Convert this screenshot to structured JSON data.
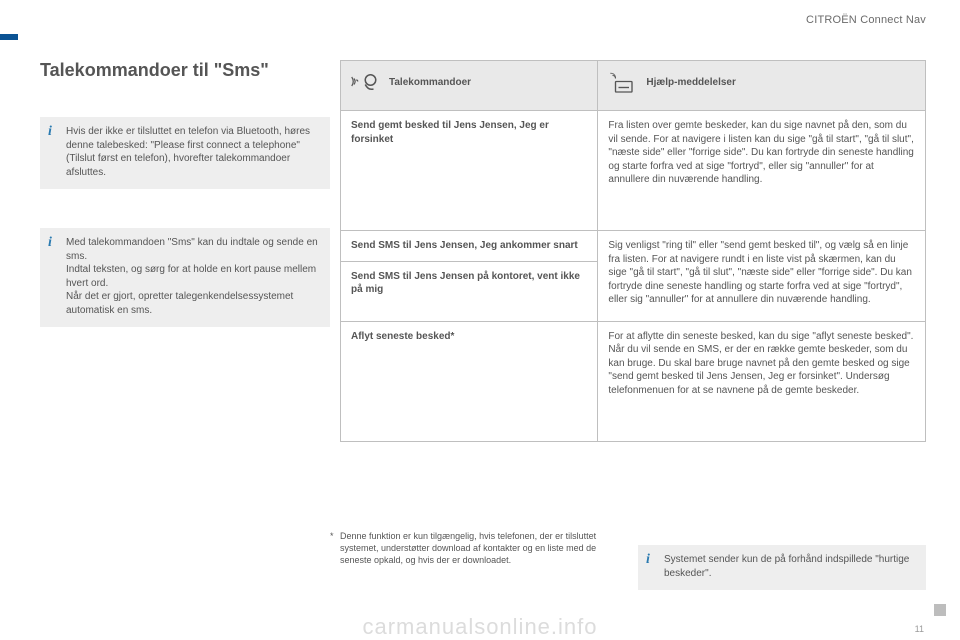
{
  "brand": "CITROËN Connect Nav",
  "title": "Talekommandoer til \"Sms\"",
  "info_boxes": {
    "info1": "Hvis der ikke er tilsluttet en telefon via Bluetooth, høres denne talebesked: \"Please first connect a telephone\" (Tilslut først en telefon), hvorefter talekommandoer afsluttes.",
    "info2": "Med talekommandoen \"Sms\" kan du indtale og sende en sms.\nIndtal teksten, og sørg for at holde en kort pause mellem hvert ord.\nNår det er gjort, opretter talegenkendelsessystemet automatisk en sms.",
    "info3": "Systemet sender kun de på forhånd indspillede \"hurtige beskeder\"."
  },
  "table": {
    "headers": {
      "col1": "Talekommandoer",
      "col2": "Hjælp-meddelelser"
    },
    "rows": [
      {
        "command": "Send gemt besked til Jens Jensen, Jeg er forsinket",
        "help": "Fra listen over gemte beskeder, kan du sige navnet på den, som du vil sende. For at navigere i listen kan du sige \"gå til start\", \"gå til slut\", \"næste side\" eller \"forrige side\". Du kan fortryde din seneste handling og starte forfra ved at sige \"fortryd\", eller sig \"annuller\" for at annullere din nuværende handling."
      },
      {
        "command": "Send SMS til Jens Jensen, Jeg ankommer snart",
        "help": "Sig venligst \"ring til\" eller \"send gemt besked til\", og vælg så en linje fra listen. For at navigere rundt i en liste vist på skærmen, kan du sige \"gå til start\", \"gå til slut\", \"næste side\" eller \"forrige side\". Du kan fortryde dine seneste handling og starte forfra ved at sige \"fortryd\", eller sig \"annuller\" for at annullere din nuværende handling."
      },
      {
        "command": "Send SMS til Jens Jensen på kontoret, vent ikke på mig",
        "help": ""
      },
      {
        "command": "Aflyt seneste besked*",
        "help": "For at aflytte din seneste besked, kan du sige \"aflyt seneste besked\". Når du vil sende en SMS, er der en række gemte beskeder, som du kan bruge. Du skal bare bruge navnet på den gemte besked og sige \"send gemt besked til Jens Jensen, Jeg er forsinket\". Undersøg telefonmenuen for at se navnene på de gemte beskeder."
      }
    ]
  },
  "footnote": "Denne funktion er kun tilgængelig, hvis telefonen, der er tilsluttet systemet, understøtter download af kontakter og en liste med de seneste opkald, og hvis der er downloadet.",
  "footnote_marker": "*",
  "watermark": "carmanualsonline.info",
  "page_number": "11",
  "icons": {
    "voice": "voice-icon",
    "help": "help-device-icon"
  }
}
